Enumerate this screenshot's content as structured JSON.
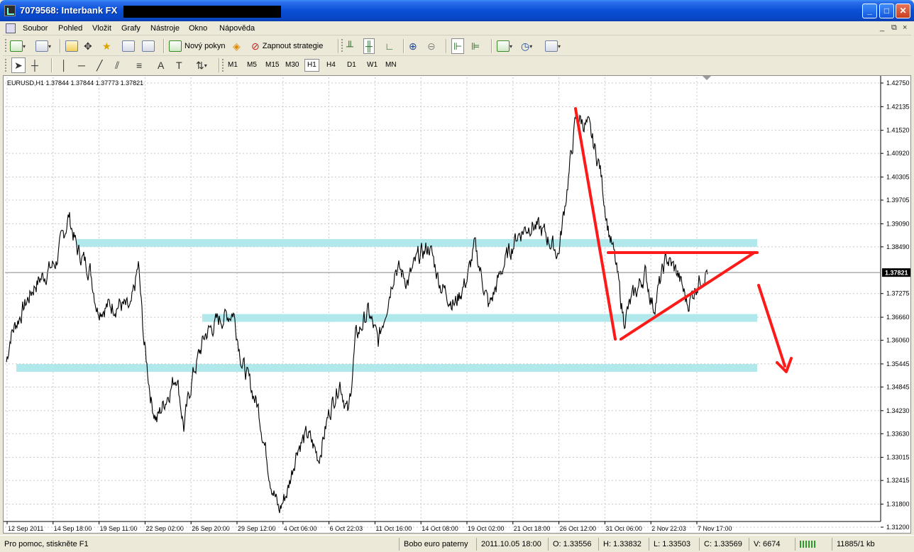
{
  "window": {
    "title": "7079568: Interbank FX",
    "controls": {
      "minimize": "_",
      "maximize": "□",
      "close": "✕"
    }
  },
  "menu": {
    "items": [
      "Soubor",
      "Pohled",
      "Vložit",
      "Grafy",
      "Nástroje",
      "Okno",
      "Nápověda"
    ],
    "mdi_controls": [
      "_",
      "⧉",
      "×"
    ]
  },
  "toolbar": {
    "new_order_label": "Nový pokyn",
    "strategy_label": "Zapnout strategie",
    "timeframes": [
      "M1",
      "M5",
      "M15",
      "M30",
      "H1",
      "H4",
      "D1",
      "W1",
      "MN"
    ],
    "selected_timeframe": "H1",
    "icons": [
      "new-chart-icon",
      "profiles-icon",
      "market-watch-icon",
      "crosshair-icon",
      "favorites-icon",
      "navigator-icon",
      "terminal-icon",
      "new-order-icon",
      "expert-advisors-icon",
      "bar-chart-icon",
      "candlestick-icon",
      "line-chart-icon",
      "zoom-in-icon",
      "zoom-out-icon",
      "chart-shift-icon",
      "autoscroll-icon",
      "indicators-icon",
      "periods-icon",
      "templates-icon",
      "cursor-icon",
      "crosshair-tool-icon",
      "vertical-line-icon",
      "horizontal-line-icon",
      "trendline-icon",
      "fibonacci-icon",
      "fibonacci-fan-icon",
      "text-icon",
      "text-label-icon",
      "arrows-icon"
    ]
  },
  "chart": {
    "symbol_line": "EURUSD,H1  1.37844 1.37844 1.37773 1.37821",
    "current_price": "1.37821",
    "price_ticks": [
      "1.42750",
      "1.42135",
      "1.41520",
      "1.40920",
      "1.40305",
      "1.39705",
      "1.39090",
      "1.38490",
      "1.37275",
      "1.36660",
      "1.36060",
      "1.35445",
      "1.34845",
      "1.34230",
      "1.33630",
      "1.33015",
      "1.32415",
      "1.31800",
      "1.31200"
    ],
    "time_ticks": [
      "12 Sep 2011",
      "14 Sep 18:00",
      "19 Sep 11:00",
      "22 Sep 02:00",
      "26 Sep 20:00",
      "29 Sep 12:00",
      "4 Oct 06:00",
      "6 Oct 22:03",
      "11 Oct 16:00",
      "14 Oct 08:00",
      "19 Oct 02:00",
      "21 Oct 18:00",
      "26 Oct 12:00",
      "31 Oct 06:00",
      "2 Nov 22:03",
      "7 Nov 17:00"
    ],
    "colors": {
      "price_line": "#000000",
      "zones": "#B0E8EC",
      "pattern": "#FF1A1A",
      "grid": "#C8C8C8"
    }
  },
  "chart_data": {
    "type": "line",
    "x": [
      "12 Sep 2011",
      "14 Sep 18:00",
      "19 Sep 11:00",
      "22 Sep 02:00",
      "26 Sep 20:00",
      "29 Sep 12:00",
      "4 Oct 06:00",
      "6 Oct 22:03",
      "11 Oct 16:00",
      "14 Oct 08:00",
      "19 Oct 02:00",
      "21 Oct 18:00",
      "26 Oct 12:00",
      "31 Oct 06:00",
      "2 Nov 22:03",
      "7 Nov 17:00"
    ],
    "series": [
      {
        "name": "EURUSD,H1",
        "values": [
          1.362,
          1.384,
          1.371,
          1.344,
          1.366,
          1.343,
          1.318,
          1.34,
          1.381,
          1.378,
          1.376,
          1.388,
          1.419,
          1.371,
          1.374,
          1.378
        ]
      }
    ],
    "ylim": [
      1.312,
      1.4275
    ],
    "support_resistance_zones": [
      1.386,
      1.3665,
      1.3535
    ],
    "grid": true
  },
  "status": {
    "help": "Pro pomoc, stiskněte F1",
    "profile": "Bobo euro paterny",
    "datetime": "2011.10.05 18:00",
    "open": "O: 1.33556",
    "high": "H: 1.33832",
    "low": "L: 1.33503",
    "close": "C: 1.33569",
    "volume": "V: 6674",
    "traffic": "11885/1 kb"
  }
}
